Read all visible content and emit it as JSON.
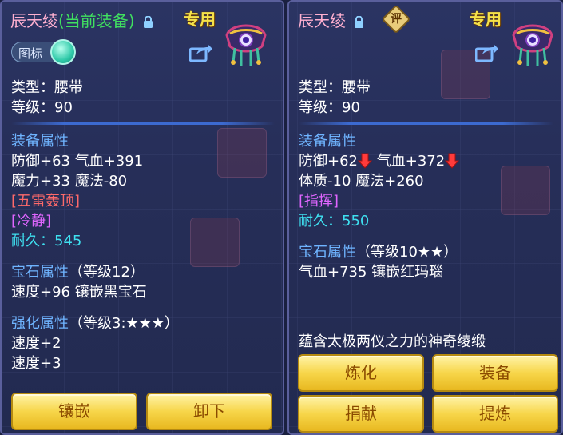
{
  "left": {
    "title_name": "辰天绫",
    "title_status": "(当前装备)",
    "exclusive": "专用",
    "toggle_label": "图标",
    "type_line": "类型：腰带",
    "level_line": "等级：90",
    "attr_header": "装备属性",
    "attr_lines": [
      "防御+63 气血+391",
      "魔力+33 魔法-80"
    ],
    "skill": "[五雷轰顶]",
    "special": "[冷静]",
    "durability_label": "耐久：",
    "durability_value": "545",
    "gem_header": "宝石属性",
    "gem_level": "（等级12）",
    "gem_line": "速度+96 镶嵌黑宝石",
    "enhance_header": "强化属性",
    "enhance_level": "（等级3:★★★）",
    "enhance_lines": [
      "速度+2",
      "速度+3"
    ],
    "buttons": [
      "镶嵌",
      "卸下"
    ]
  },
  "right": {
    "title_name": "辰天绫",
    "eval_badge": "评",
    "exclusive": "专用",
    "type_line": "类型：腰带",
    "level_line": "等级：90",
    "attr_header": "装备属性",
    "attr_line1_a": "防御+62",
    "attr_line1_b": "气血+372",
    "attr_line2": "体质-10 魔法+260",
    "special": "[指挥]",
    "durability_label": "耐久：",
    "durability_value": "550",
    "gem_header": "宝石属性",
    "gem_level": "（等级10★★）",
    "gem_line": "气血+735 镶嵌红玛瑙",
    "description": "蕴含太极两仪之力的神奇绫缎",
    "buttons": [
      "炼化",
      "装备",
      "捐献",
      "提炼"
    ]
  },
  "colors": {
    "panel_bg": "#262e58",
    "section_blue": "#6fb4ff",
    "skill_red": "#ff6a6a",
    "special_purple": "#e066ff",
    "durability_cyan": "#3fe0f0",
    "exclusive_yellow": "#f5e24a",
    "button_gold": "#f7d64a"
  },
  "icons": [
    "lock-icon",
    "share-icon",
    "item-icon",
    "down-arrow-icon",
    "eval-badge"
  ]
}
